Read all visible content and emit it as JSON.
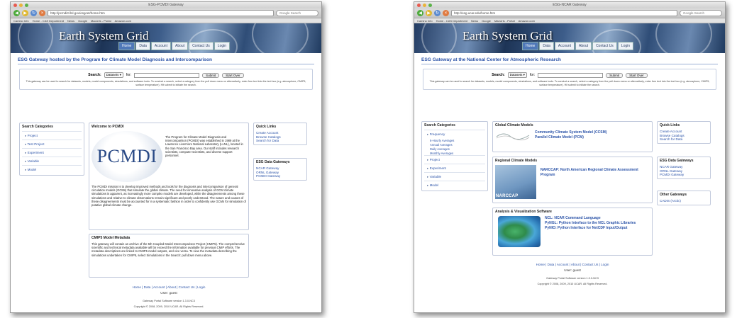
{
  "left_window": {
    "window_title": "ESG-PCMDI Gateway",
    "url": "http://pcmdi3.llnl.gov/esgcet/home.htm",
    "search_placeholder": "Google Search",
    "bookmarks": [
      "Camino Info",
      "Home - CAS Department",
      "News",
      "Google",
      "MacUrls - Portal",
      "Amazon.com"
    ],
    "banner_title": "Earth System Grid",
    "nav_tabs": [
      "Home",
      "Data",
      "Account",
      "About",
      "Contact Us",
      "Login"
    ],
    "page_heading": "ESG Gateway hosted by the Program for Climate Model Diagnosis and Intercomparison",
    "search": {
      "label": "Search:",
      "category": "Datasets",
      "for_label": "for:",
      "query": "",
      "submit": "Submit",
      "start_over": "Start Over",
      "help": "This gateway can be used to search for datasets, models, model components, simulations, and software tools. To conduct a search, select a category from the pull down menu or alternatively, enter free text into the text box (e.g. atmosphere, CMIP5, surface temperature). Hit submit to initiate the search."
    },
    "categories": {
      "heading": "Search Categories",
      "items": [
        "Project",
        "Test Project",
        "Experiment",
        "Variable",
        "Model"
      ]
    },
    "welcome": {
      "heading": "Welcome to PCMDI",
      "logo_text": "PCMDI",
      "intro": "The Program for Climate Model Diagnosis and Intercomparison (PCMDI) was established in 1989 at the Lawrence Livermore National Laboratory (LLNL), located in the San Francisco Bay area. Our staff includes research scientists, computer scientists, and diverse support personnel.",
      "mission": "The PCMDI mission is to develop improved methods and tools for the diagnosis and intercomparison of general circulation models (GCMs) that simulate the global climate. The need for innovative analysis of GCM climate simulations is apparent, as increasingly more complex models are developed, while the disagreements among these simulations and relative to climate observations remain significant and poorly understood. The nature and causes of these disagreements must be accounted for in a systematic fashion in order to confidently use GCMs for simulation of putative global climate change."
    },
    "cmip5": {
      "heading": "CMIP5 Model Metadata",
      "body": "This gateway will contain an archive of the 5th Coupled Model Intercomparison Project (CMIP5). The comprehensive scientific and technical metadata available will far exceed the information available for previous CMIP efforts. The metadata descriptions are linked to CMIP5 model outputs, and vice versa. To view the metadata describing the simulations undertaken for CMIP5, select Simulations in the Search: pull down menu above."
    },
    "quick_links": {
      "heading": "Quick Links",
      "items": [
        "Create Account",
        "Browse Catalogs",
        "Search for Data"
      ]
    },
    "esg_gateways": {
      "heading": "ESG Data Gateways",
      "items": [
        "NCAR Gateway",
        "ORNL Gateway",
        "PCMDI Gateway"
      ]
    },
    "footer": {
      "links": "Home | Data | Account | About | Contact Us | Login",
      "user": "User: guest",
      "version": "Gateway Portal Software version 1.3.0-NC3",
      "copyright": "Copyright © 2008, 2009, 2010 UCAR. All Rights Reserved."
    }
  },
  "right_window": {
    "window_title": "ESG-NCAR Gateway",
    "url": "http://esg.ucar.edu/home.htm",
    "search_placeholder": "Google Search",
    "bookmarks": [
      "Camino Info",
      "Home - CAS Department",
      "News",
      "Google",
      "MacUrls - Portal",
      "Amazon.com"
    ],
    "banner_title": "Earth System Grid",
    "nav_tabs": [
      "Home",
      "Data",
      "Account",
      "About",
      "Contact Us",
      "Login"
    ],
    "page_heading": "ESG Gateway at the National Center for Atmospheric Research",
    "search": {
      "label": "Search:",
      "category": "Datasets",
      "for_label": "for:",
      "query": "",
      "submit": "Submit",
      "start_over": "Start Over",
      "help": "This gateway can be used to search for datasets, models, model components, simulations, and software tools. To conduct a search, select a category from the pull down menu or alternatively, enter free text into the text box (e.g. atmosphere, CMIP5, surface temperature). Hit submit to initiate the search."
    },
    "categories": {
      "heading": "Search Categories",
      "frequency": "Frequency",
      "frequency_items": [
        "6-Hourly Averages",
        "Annual Averages",
        "Daily Averages",
        "Monthly Averages"
      ],
      "items": [
        "Project",
        "Experiment",
        "Variable",
        "Model"
      ]
    },
    "global_models": {
      "heading": "Global Climate Models",
      "items": [
        "Community Climate System Model (CCSM)",
        "Parallel Climate Model (PCM)"
      ]
    },
    "regional_models": {
      "heading": "Regional Climate Models",
      "logo_text": "NARCCAP",
      "items": [
        "NARCCAP: North American Regional Climate Assessment Program"
      ]
    },
    "analysis": {
      "heading": "Analysis & Visualization Software",
      "items": [
        "NCL: NCAR Command Language",
        "PyNGL: Python Interface to the NCL Graphic Libraries",
        "PyNIO: Python Interface for NetCDF Input/Output"
      ]
    },
    "quick_links": {
      "heading": "Quick Links",
      "items": [
        "Create Account",
        "Browse Catalogs",
        "Search for Data"
      ]
    },
    "esg_gateways": {
      "heading": "ESG Data Gateways",
      "items": [
        "NCAR Gateway",
        "ORNL Gateway",
        "PCMDI Gateway"
      ]
    },
    "other_gateways": {
      "heading": "Other Gateways",
      "items": [
        "CADIS (Arctic)"
      ]
    },
    "footer": {
      "links": "Home | Data | Account | About | Contact Us | Login",
      "user": "User: guest",
      "version": "Gateway Portal Software version 1.3.0-NC3",
      "copyright": "Copyright © 2008, 2009, 2010 UCAR. All Rights Reserved."
    }
  }
}
